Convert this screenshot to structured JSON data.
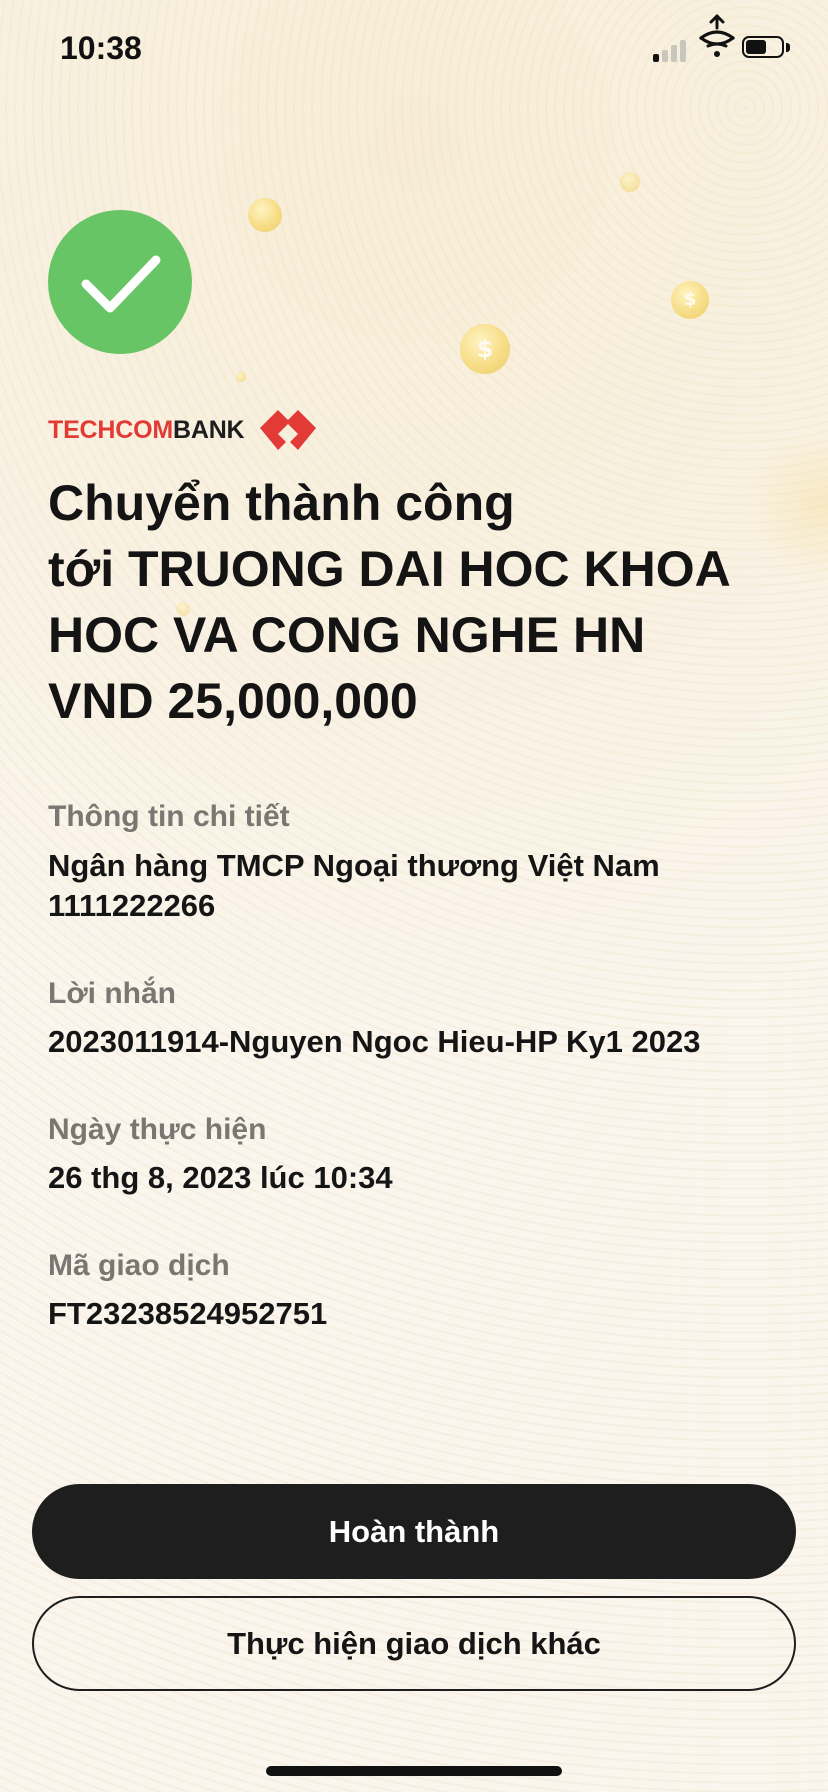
{
  "status_bar": {
    "time": "10:38",
    "signal_bars_active": 1,
    "signal_bars_total": 4,
    "battery_level": 0.5
  },
  "success": {
    "icon": "check-icon",
    "color": "#67c566"
  },
  "logo": {
    "text_part1": "TECHCOM",
    "text_part2": "BANK",
    "brand_red": "#e23b36"
  },
  "heading": {
    "line1": "Chuyển thành công",
    "line2": "tới TRUONG DAI HOC KHOA",
    "line3": "HOC VA CONG NGHE HN",
    "line4": "VND 25,000,000"
  },
  "details": {
    "info_label": "Thông tin chi tiết",
    "bank_name": "Ngân hàng TMCP Ngoại thương Việt Nam",
    "account_number": "1111222266",
    "message_label": "Lời nhắn",
    "message_value": "2023011914-Nguyen Ngoc Hieu-HP Ky1 2023",
    "date_label": "Ngày thực hiện",
    "date_value": "26 thg 8, 2023 lúc 10:34",
    "txn_label": "Mã giao dịch",
    "txn_value": "FT23238524952751"
  },
  "buttons": {
    "done": "Hoàn thành",
    "new_transaction": "Thực hiện giao dịch khác"
  },
  "decor": {
    "coin_symbol": "$"
  }
}
